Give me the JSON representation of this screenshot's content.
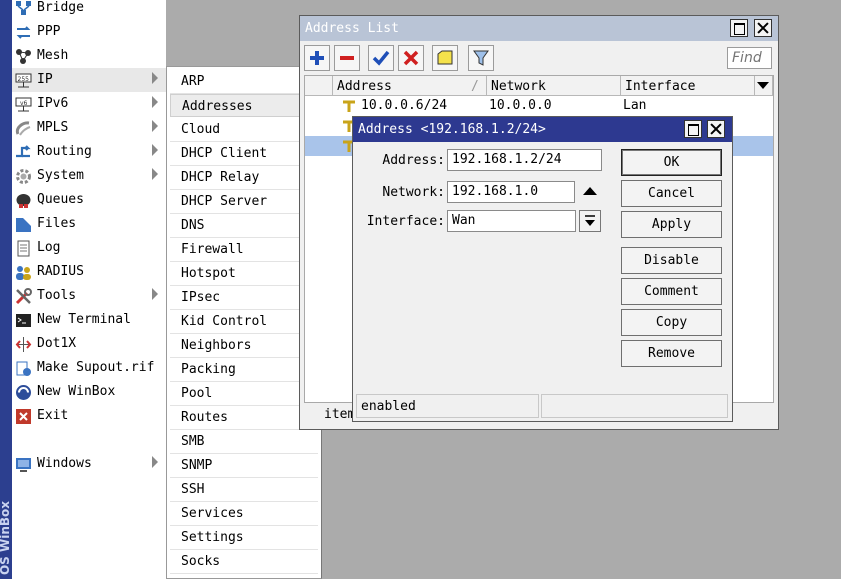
{
  "brand_strip": "OS WinBox",
  "main_menu": {
    "items": [
      {
        "label": "Bridge",
        "icon": "bridge-icon",
        "arrow": false
      },
      {
        "label": "PPP",
        "icon": "ppp-icon",
        "arrow": false
      },
      {
        "label": "Mesh",
        "icon": "mesh-icon",
        "arrow": false
      },
      {
        "label": "IP",
        "icon": "ip-icon",
        "arrow": true,
        "selected": true
      },
      {
        "label": "IPv6",
        "icon": "ipv6-icon",
        "arrow": true
      },
      {
        "label": "MPLS",
        "icon": "mpls-icon",
        "arrow": true
      },
      {
        "label": "Routing",
        "icon": "routing-icon",
        "arrow": true
      },
      {
        "label": "System",
        "icon": "system-gear-icon",
        "arrow": true
      },
      {
        "label": "Queues",
        "icon": "queues-icon",
        "arrow": false
      },
      {
        "label": "Files",
        "icon": "folder-icon",
        "arrow": false
      },
      {
        "label": "Log",
        "icon": "log-icon",
        "arrow": false
      },
      {
        "label": "RADIUS",
        "icon": "radius-users-icon",
        "arrow": false
      },
      {
        "label": "Tools",
        "icon": "tools-icon",
        "arrow": true
      },
      {
        "label": "New Terminal",
        "icon": "terminal-icon",
        "arrow": false
      },
      {
        "label": "Dot1X",
        "icon": "dot1x-icon",
        "arrow": false
      },
      {
        "label": "Make Supout.rif",
        "icon": "supout-icon",
        "arrow": false
      },
      {
        "label": "New WinBox",
        "icon": "winbox-icon",
        "arrow": false
      },
      {
        "label": "Exit",
        "icon": "exit-icon",
        "arrow": false
      },
      {
        "label": "Windows",
        "icon": "windows-icon",
        "arrow": true
      }
    ]
  },
  "ip_submenu": {
    "items": [
      "ARP",
      "Addresses",
      "Cloud",
      "DHCP Client",
      "DHCP Relay",
      "DHCP Server",
      "DNS",
      "Firewall",
      "Hotspot",
      "IPsec",
      "Kid Control",
      "Neighbors",
      "Packing",
      "Pool",
      "Routes",
      "SMB",
      "SNMP",
      "SSH",
      "Services",
      "Settings",
      "Socks"
    ],
    "selected": "Addresses"
  },
  "address_list": {
    "title": "Address List",
    "toolbar": {
      "add": "plus-icon",
      "remove": "minus-icon",
      "enable": "check-icon",
      "disable": "x-icon",
      "comment": "note-icon",
      "filter": "filter-icon",
      "find_placeholder": "Find"
    },
    "columns": [
      "Address",
      "Network",
      "Interface"
    ],
    "rows": [
      {
        "address": "10.0.0.6/24",
        "network": "10.0.0.0",
        "interface": "Lan"
      },
      {
        "address": "",
        "network": "",
        "interface": ""
      },
      {
        "address": "",
        "network": "",
        "interface": "",
        "selected": true
      }
    ],
    "status": "item"
  },
  "dialog": {
    "title": "Address <192.168.1.2/24>",
    "fields": {
      "address_label": "Address:",
      "address_value": "192.168.1.2/24",
      "network_label": "Network:",
      "network_value": "192.168.1.0",
      "interface_label": "Interface:",
      "interface_value": "Wan"
    },
    "buttons": [
      "OK",
      "Cancel",
      "Apply",
      "Disable",
      "Comment",
      "Copy",
      "Remove"
    ],
    "status_left": "enabled",
    "status_right": ""
  },
  "colors": {
    "dialog_title": "#2d3990",
    "inactive_title": "#b9c4d6",
    "selected_row": "#a9c4ea",
    "desktop": "#ababab"
  }
}
